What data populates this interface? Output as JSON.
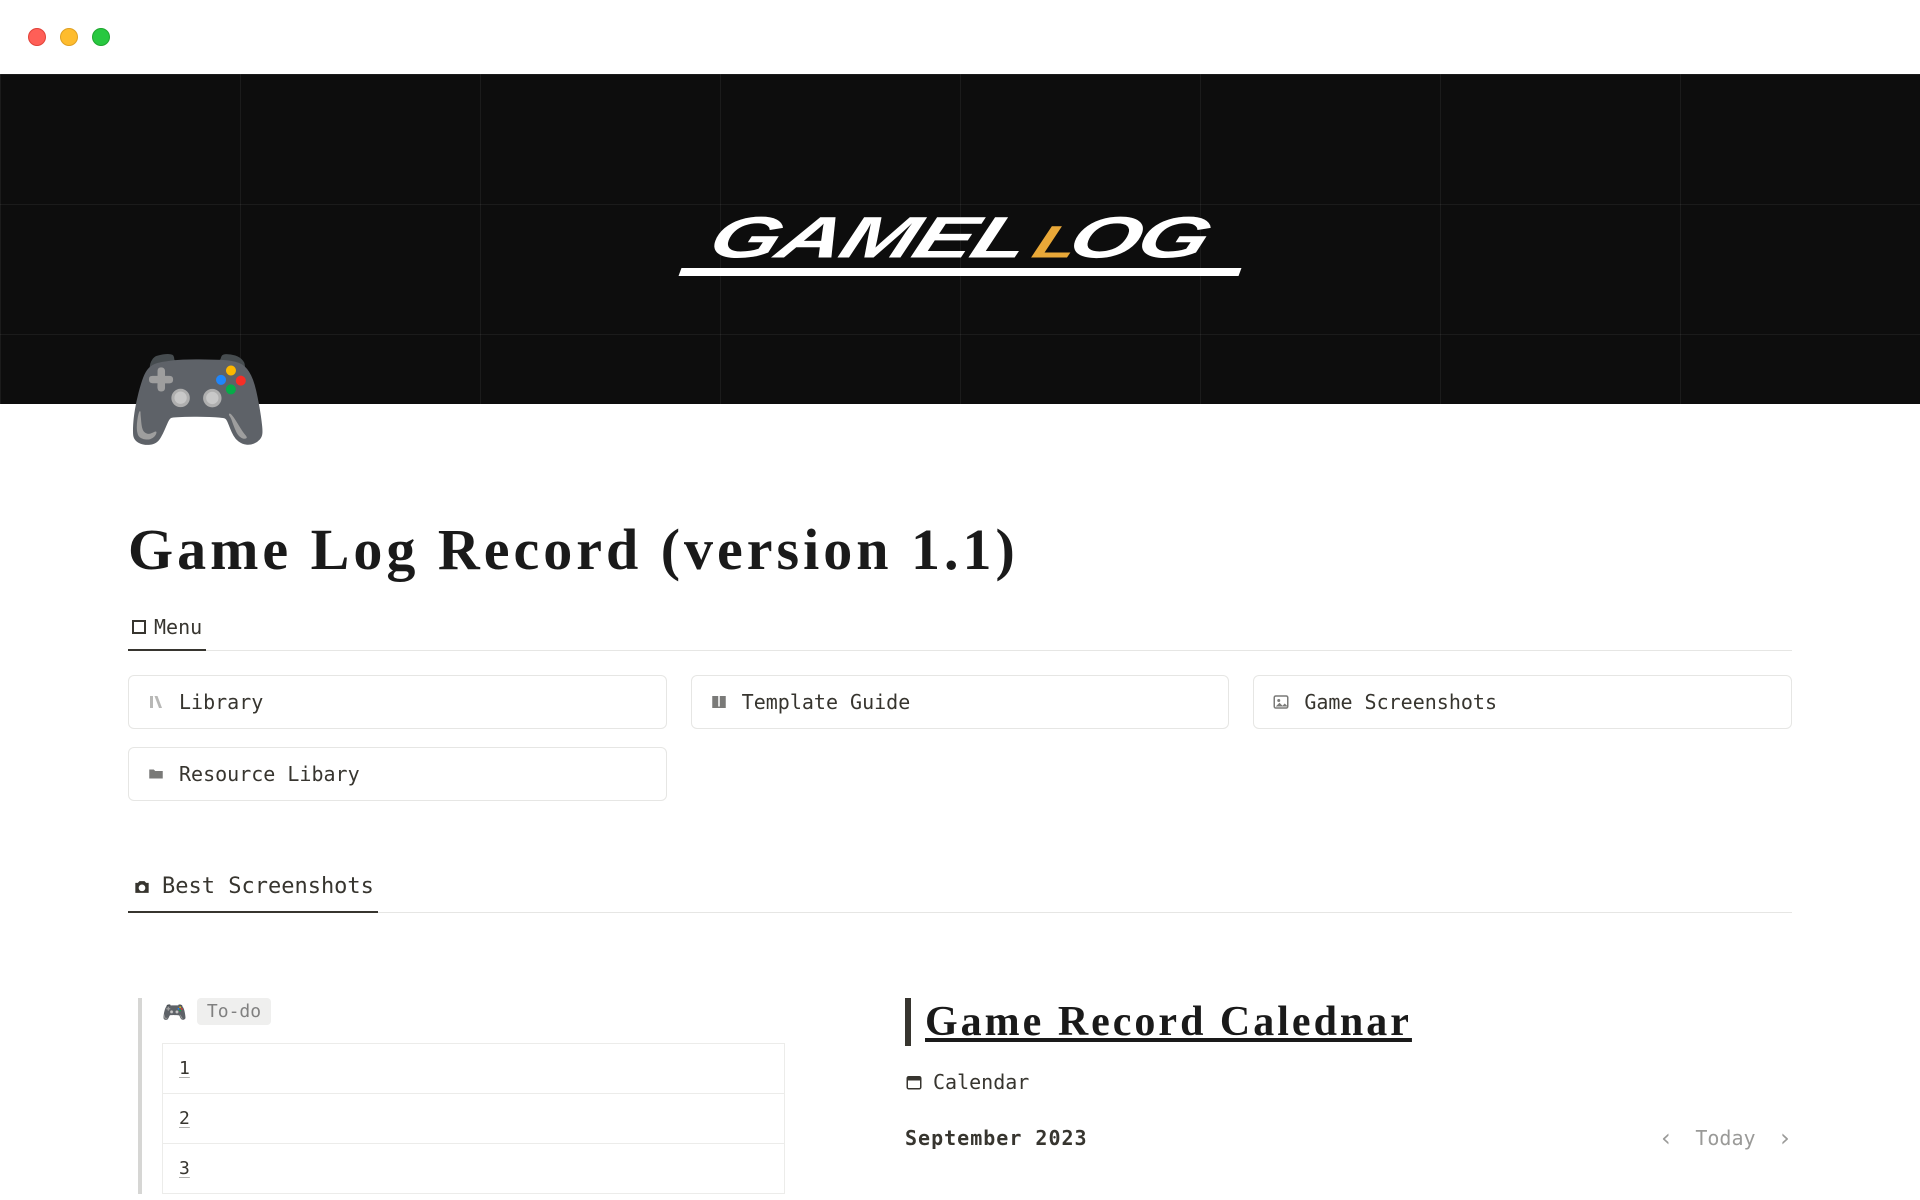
{
  "icons": {
    "page": "🎮",
    "todo_game": "🎮"
  },
  "logo": {
    "text_left": "GAMEL",
    "accent": "L",
    "text_right": "OG"
  },
  "page": {
    "title": "Game Log Record (version 1.1)"
  },
  "views": {
    "menu": {
      "label": "Menu"
    },
    "screenshots": {
      "label": "Best Screenshots"
    }
  },
  "cards": {
    "library": "Library",
    "template_guide": "Template Guide",
    "game_screenshots": "Game Screenshots",
    "resource_library": "Resource Libary"
  },
  "todo": {
    "chip": "To-do",
    "rows": [
      "1",
      "2",
      "3"
    ]
  },
  "calendar": {
    "title": "Game Record Calednar",
    "view_label": "Calendar",
    "month": "September 2023",
    "today": "Today"
  }
}
